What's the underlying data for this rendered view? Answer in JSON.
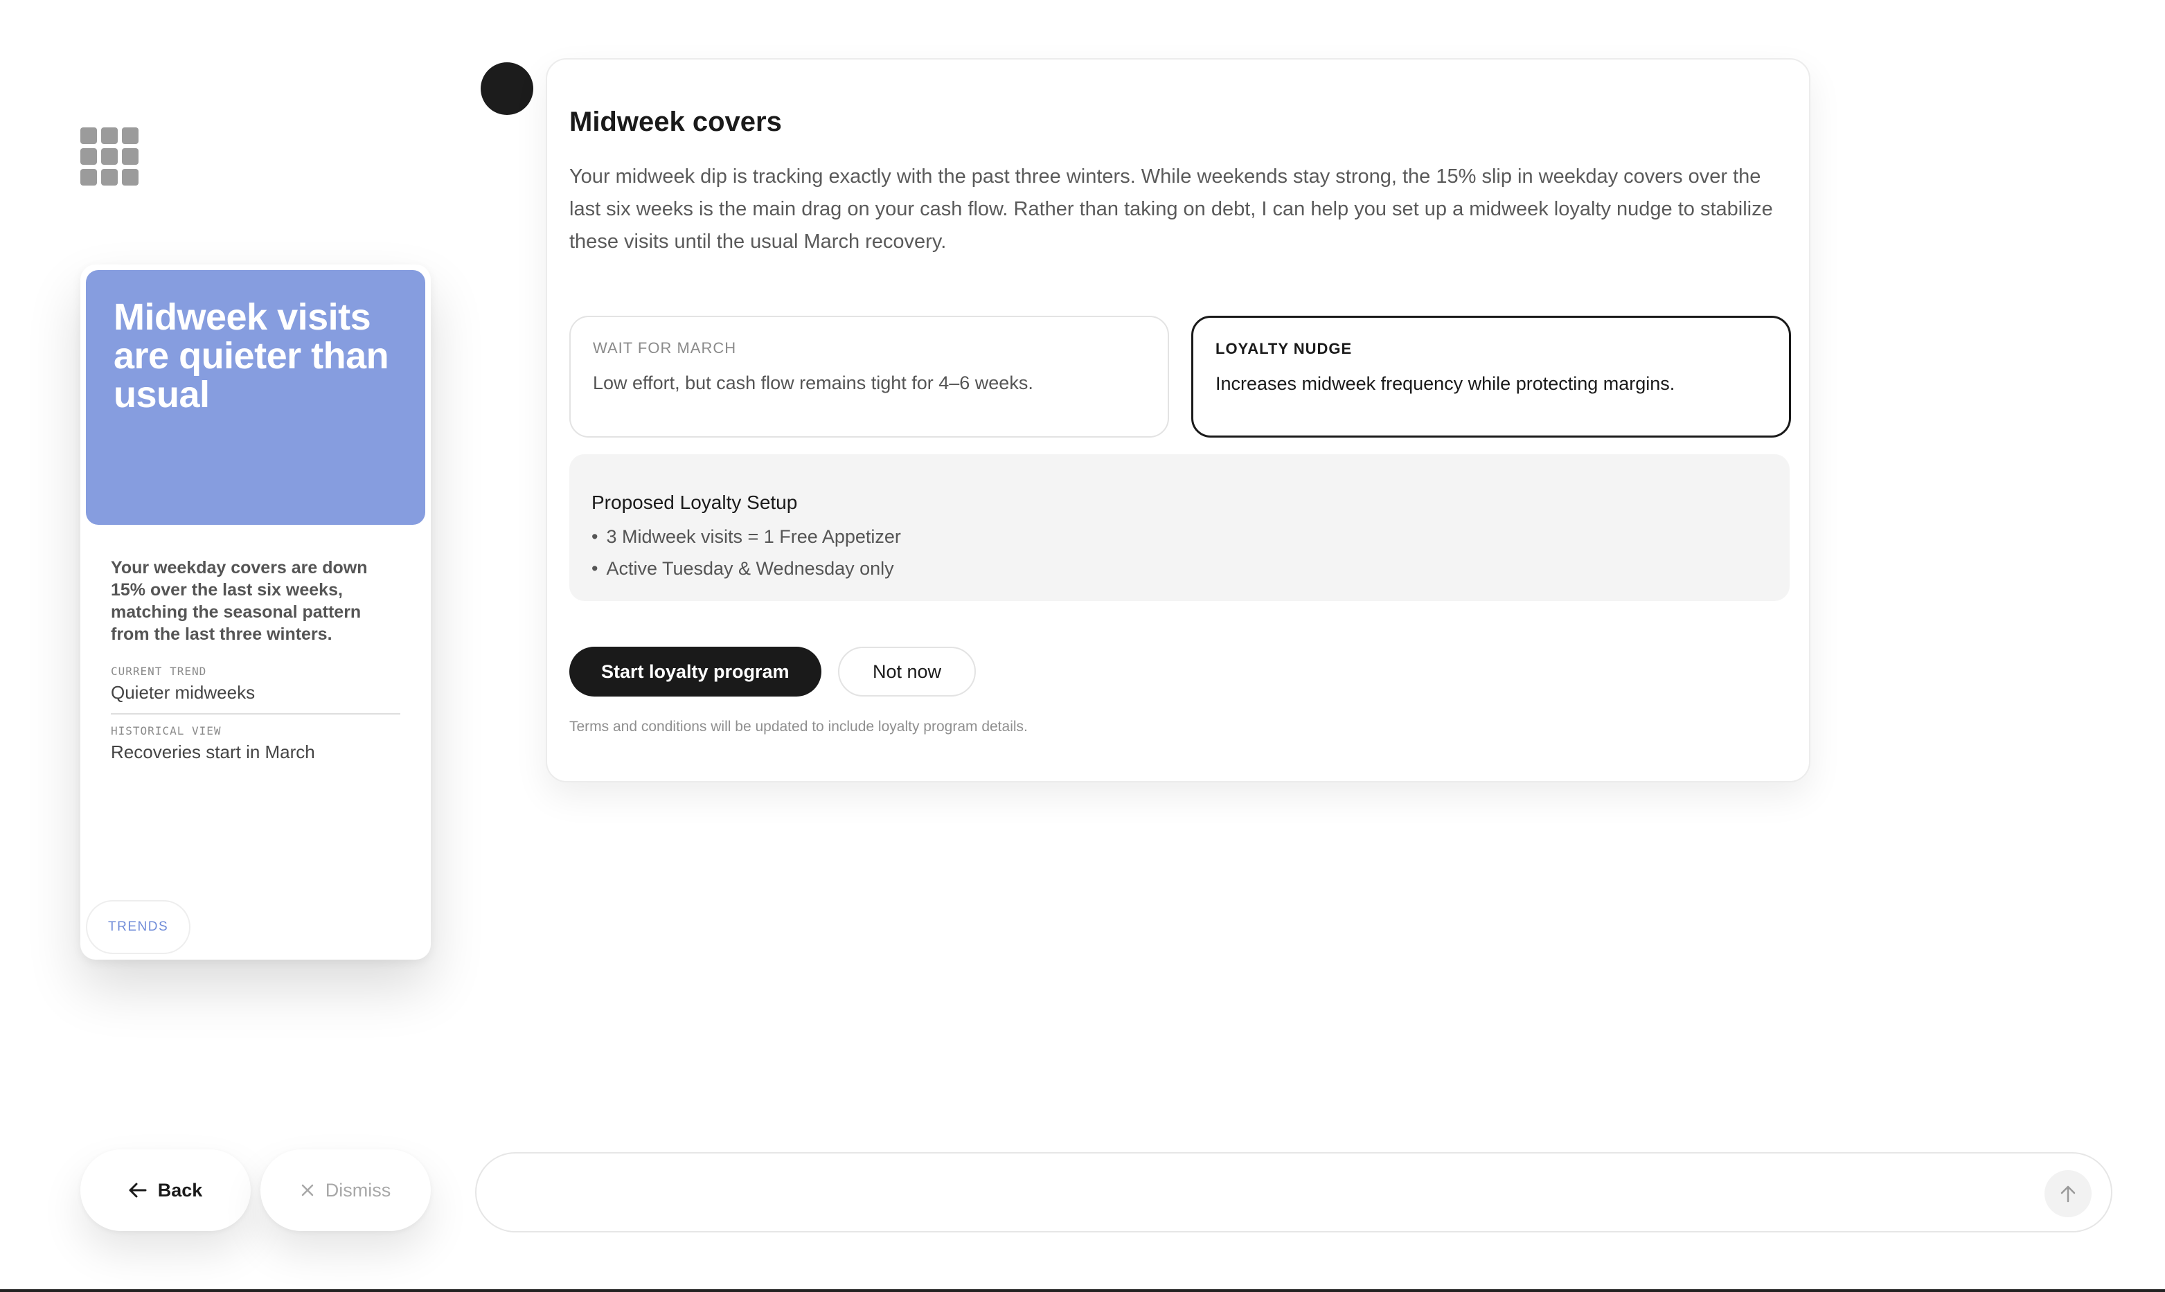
{
  "trend_card": {
    "headline": "Midweek visits are quieter than usual",
    "description": "Your weekday covers are down 15% over the last six weeks, matching the seasonal pattern from the last three winters.",
    "rows": [
      {
        "label": "CURRENT TREND",
        "value": "Quieter midweeks"
      },
      {
        "label": "HISTORICAL VIEW",
        "value": "Recoveries start in March"
      }
    ],
    "tag": "TRENDS",
    "hero_color": "#869ddf"
  },
  "nav": {
    "back_label": "Back",
    "dismiss_label": "Dismiss"
  },
  "message": {
    "title": "Midweek covers",
    "body": "Your midweek dip is tracking exactly with the past three winters. While weekends stay strong, the 15% slip in weekday covers over the last six weeks is the main drag on your cash flow. Rather than taking on debt, I can help you set up a midweek loyalty nudge to stabilize these visits until the usual March recovery.",
    "options": [
      {
        "label": "WAIT FOR MARCH",
        "desc": "Low effort, but cash flow remains tight for 4–6 weeks.",
        "selected": false
      },
      {
        "label": "LOYALTY NUDGE",
        "desc": "Increases midweek frequency while protecting margins.",
        "selected": true
      }
    ],
    "setup": {
      "title": "Proposed Loyalty Setup",
      "items": [
        "3 Midweek visits = 1 Free Appetizer",
        "Active Tuesday & Wednesday only"
      ]
    },
    "primary_label": "Start loyalty program",
    "secondary_label": "Not now",
    "terms": "Terms and conditions will be updated to include loyalty program details."
  },
  "composer": {
    "value": "",
    "placeholder": ""
  },
  "icons": {
    "apps": "grid-icon",
    "back": "arrow-left-icon",
    "dismiss": "close-icon",
    "send": "arrow-up-icon"
  }
}
